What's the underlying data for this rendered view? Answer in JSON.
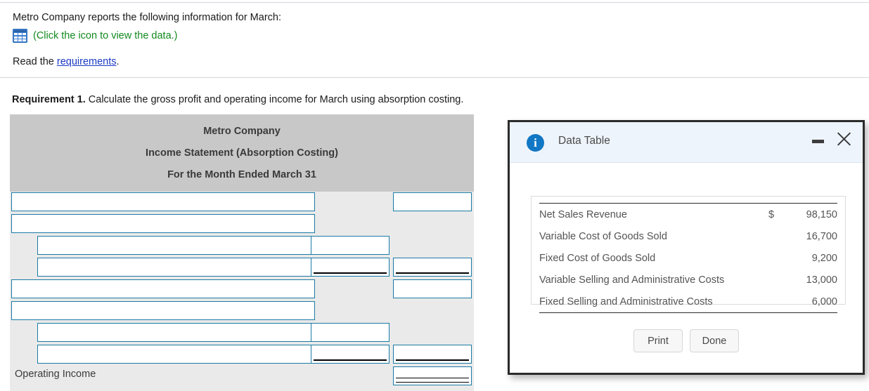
{
  "document": {
    "intro": "Metro Company reports the following information for March:",
    "icon_caption": "(Click the icon to view the data.)",
    "data_icon": "table-grid-icon",
    "read_prefix": "Read the ",
    "read_link": "requirements",
    "read_suffix": ".",
    "requirement_label": "Requirement 1.",
    "requirement_text": " Calculate the gross profit and operating income for March using absorption costing."
  },
  "worksheet": {
    "title_lines": [
      "Metro Company",
      "Income Statement (Absorption Costing)",
      "For the Month Ended March 31"
    ],
    "rows": [
      {
        "indent": "top",
        "label": "",
        "mid": false,
        "right": true,
        "rule": "none"
      },
      {
        "indent": "top",
        "label": "",
        "mid": false,
        "right": false,
        "rule": "none"
      },
      {
        "indent": "inset",
        "label": "",
        "mid": true,
        "right": false,
        "rule": "none"
      },
      {
        "indent": "inset",
        "label": "",
        "mid": true,
        "right": true,
        "rule": "single"
      },
      {
        "indent": "top",
        "label": "",
        "mid": false,
        "right": true,
        "rule": "none"
      },
      {
        "indent": "top",
        "label": "",
        "mid": false,
        "right": false,
        "rule": "none"
      },
      {
        "indent": "inset",
        "label": "",
        "mid": true,
        "right": false,
        "rule": "none"
      },
      {
        "indent": "inset",
        "label": "",
        "mid": true,
        "right": true,
        "rule": "single"
      },
      {
        "indent": "static",
        "label": "Operating Income",
        "mid": false,
        "right": true,
        "rule": "double"
      }
    ]
  },
  "dialog": {
    "title": "Data Table",
    "info_icon": "info-icon",
    "minimize_icon": "minimize-icon",
    "close_icon": "close-icon",
    "table": {
      "rows": [
        {
          "name": "Net Sales Revenue",
          "currency": "$",
          "value": "98,150"
        },
        {
          "name": "Variable Cost of Goods Sold",
          "currency": "",
          "value": "16,700"
        },
        {
          "name": "Fixed Cost of Goods Sold",
          "currency": "",
          "value": "9,200"
        },
        {
          "name": "Variable Selling and Administrative Costs",
          "currency": "",
          "value": "13,000"
        },
        {
          "name": "Fixed Selling and Administrative Costs",
          "currency": "",
          "value": "6,000"
        }
      ]
    },
    "buttons": {
      "print": "Print",
      "done": "Done"
    }
  },
  "colors": {
    "link": "#1a39c4",
    "icon_caption": "#128a1f",
    "input_border": "#1a7ba4",
    "worksheet_header_bg": "#c8c8c8",
    "worksheet_body_bg": "#eaeaea",
    "dialog_title_bg": "#eef4fb",
    "info_blue": "#1277c4"
  }
}
